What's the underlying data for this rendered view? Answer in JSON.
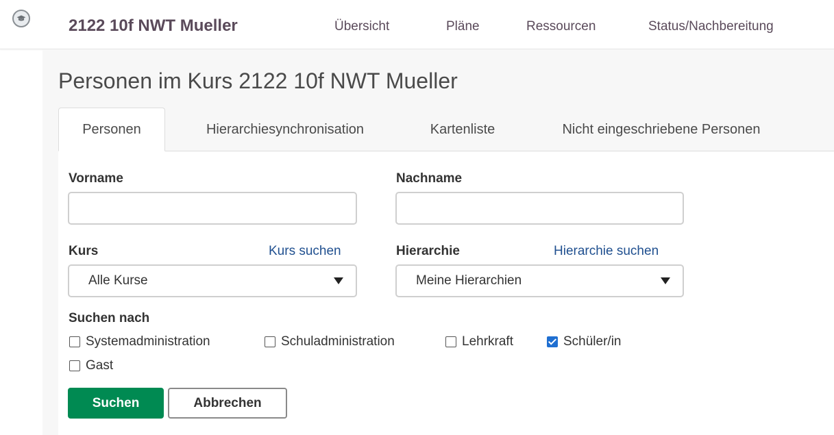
{
  "header": {
    "course_title": "2122 10f NWT Mueller",
    "nav": [
      "Übersicht",
      "Pläne",
      "Ressourcen",
      "Status/Nachbereitung"
    ],
    "logo_icon": "graduation-cap-icon"
  },
  "page": {
    "heading": "Personen im Kurs 2122 10f NWT Mueller"
  },
  "tabs": [
    "Personen",
    "Hierarchiesynchronisation",
    "Kartenliste",
    "Nicht eingeschriebene Personen"
  ],
  "form": {
    "firstname_label": "Vorname",
    "firstname_value": "",
    "lastname_label": "Nachname",
    "lastname_value": "",
    "course_label": "Kurs",
    "course_link": "Kurs suchen",
    "course_value": "Alle Kurse",
    "hierarchy_label": "Hierarchie",
    "hierarchy_link": "Hierarchie suchen",
    "hierarchy_value": "Meine Hierarchien",
    "search_by_label": "Suchen nach",
    "roles": [
      {
        "label": "Systemadministration",
        "checked": false
      },
      {
        "label": "Schuladministration",
        "checked": false
      },
      {
        "label": "Lehrkraft",
        "checked": false
      },
      {
        "label": "Schüler/in",
        "checked": true
      },
      {
        "label": "Gast",
        "checked": false
      }
    ],
    "search_button": "Suchen",
    "cancel_button": "Abbrechen"
  },
  "colors": {
    "primary": "#008a52",
    "link": "#1f4f8f",
    "nav_text": "#5a4a5a",
    "checkbox_checked": "#1f6fd1"
  }
}
